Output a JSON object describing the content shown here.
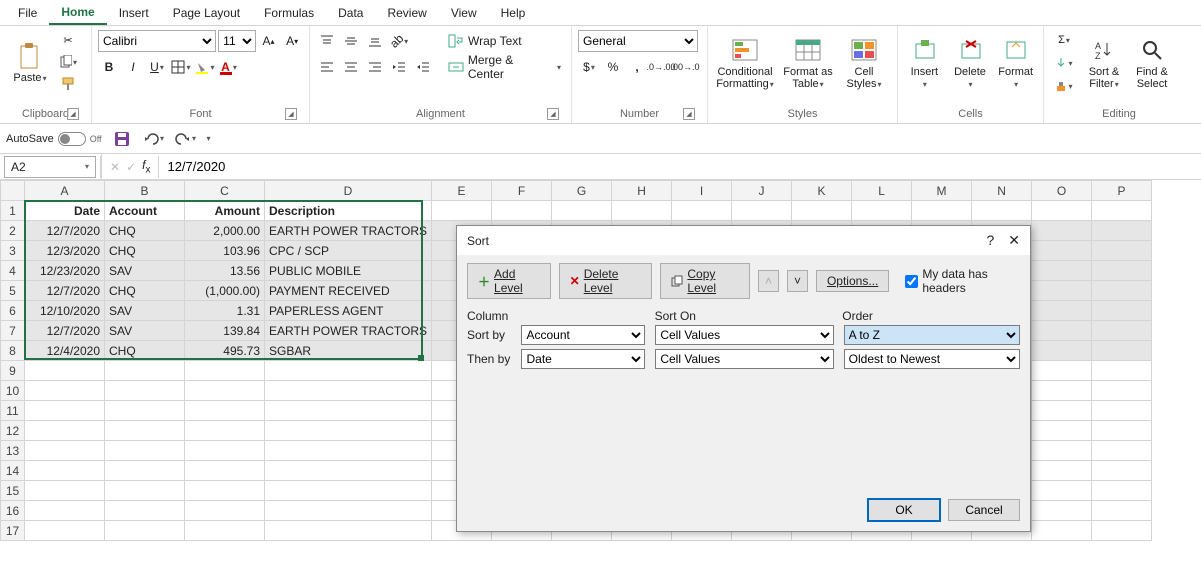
{
  "menubar": [
    "File",
    "Home",
    "Insert",
    "Page Layout",
    "Formulas",
    "Data",
    "Review",
    "View",
    "Help"
  ],
  "menubar_active_index": 1,
  "ribbon": {
    "clipboard": {
      "paste": "Paste",
      "label": "Clipboard"
    },
    "font": {
      "name": "Calibri",
      "size": "11",
      "label": "Font"
    },
    "alignment": {
      "wrap": "Wrap Text",
      "merge": "Merge & Center",
      "label": "Alignment"
    },
    "number": {
      "format": "General",
      "label": "Number"
    },
    "styles": {
      "cond": "Conditional\nFormatting",
      "table": "Format as\nTable",
      "cell": "Cell\nStyles",
      "label": "Styles"
    },
    "cells": {
      "insert": "Insert",
      "delete": "Delete",
      "format": "Format",
      "label": "Cells"
    },
    "editing": {
      "sort": "Sort &\nFilter",
      "find": "Find &\nSelect",
      "label": "Editing"
    }
  },
  "qat": {
    "autosave": "AutoSave",
    "autosave_state": "Off"
  },
  "namebox": "A2",
  "formula": "12/7/2020",
  "columns": [
    "A",
    "B",
    "C",
    "D",
    "E",
    "F",
    "G",
    "H",
    "I",
    "J",
    "K",
    "L",
    "M",
    "N",
    "O",
    "P"
  ],
  "headers": {
    "A": "Date",
    "B": "Account",
    "C": "Amount",
    "D": "Description"
  },
  "rows": [
    {
      "r": 2,
      "A": "12/7/2020",
      "B": "CHQ",
      "C": "2,000.00",
      "D": "EARTH POWER TRACTORS"
    },
    {
      "r": 3,
      "A": "12/3/2020",
      "B": "CHQ",
      "C": "103.96",
      "D": "CPC / SCP"
    },
    {
      "r": 4,
      "A": "12/23/2020",
      "B": "SAV",
      "C": "13.56",
      "D": "PUBLIC MOBILE"
    },
    {
      "r": 5,
      "A": "12/7/2020",
      "B": "CHQ",
      "C": "(1,000.00)",
      "D": "PAYMENT RECEIVED"
    },
    {
      "r": 6,
      "A": "12/10/2020",
      "B": "SAV",
      "C": "1.31",
      "D": "PAPERLESS AGENT"
    },
    {
      "r": 7,
      "A": "12/7/2020",
      "B": "SAV",
      "C": "139.84",
      "D": "EARTH POWER TRACTORS"
    },
    {
      "r": 8,
      "A": "12/4/2020",
      "B": "CHQ",
      "C": "495.73",
      "D": "SGBAR"
    }
  ],
  "empty_rows": [
    9,
    10,
    11,
    12,
    13,
    14,
    15,
    16,
    17
  ],
  "dialog": {
    "title": "Sort",
    "add": "Add Level",
    "delete": "Delete Level",
    "copy": "Copy Level",
    "options": "Options...",
    "headers_chk": "My data has headers",
    "col_hdrs": [
      "Column",
      "Sort On",
      "Order"
    ],
    "levels": [
      {
        "label": "Sort by",
        "col": "Account",
        "on": "Cell Values",
        "order": "A to Z",
        "hl": true
      },
      {
        "label": "Then by",
        "col": "Date",
        "on": "Cell Values",
        "order": "Oldest to Newest",
        "hl": false
      }
    ],
    "ok": "OK",
    "cancel": "Cancel"
  },
  "chart_data": {
    "type": "table",
    "columns": [
      "Date",
      "Account",
      "Amount",
      "Description"
    ],
    "rows": [
      [
        "12/7/2020",
        "CHQ",
        2000.0,
        "EARTH POWER TRACTORS"
      ],
      [
        "12/3/2020",
        "CHQ",
        103.96,
        "CPC / SCP"
      ],
      [
        "12/23/2020",
        "SAV",
        13.56,
        "PUBLIC MOBILE"
      ],
      [
        "12/7/2020",
        "CHQ",
        -1000.0,
        "PAYMENT RECEIVED"
      ],
      [
        "12/10/2020",
        "SAV",
        1.31,
        "PAPERLESS AGENT"
      ],
      [
        "12/7/2020",
        "SAV",
        139.84,
        "EARTH POWER TRACTORS"
      ],
      [
        "12/4/2020",
        "CHQ",
        495.73,
        "SGBAR"
      ]
    ]
  }
}
